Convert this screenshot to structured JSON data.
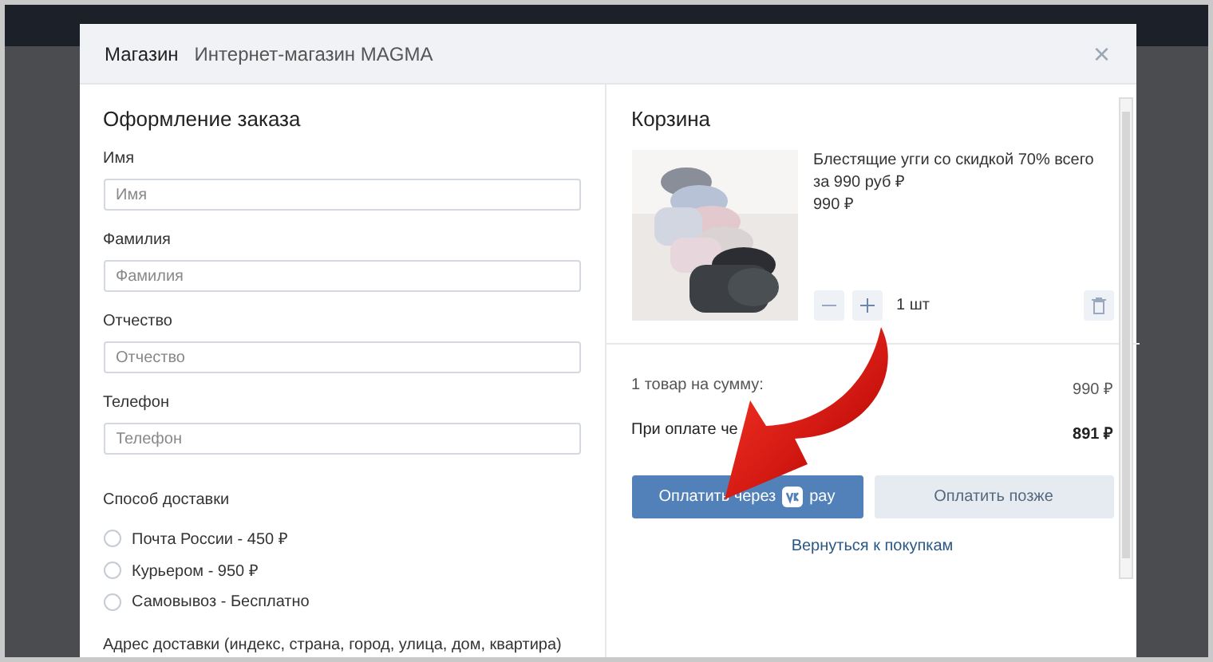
{
  "header": {
    "section": "Магазин",
    "shop": "Интернет-магазин MAGMA",
    "close": "×"
  },
  "form": {
    "title": "Оформление заказа",
    "fields": [
      {
        "label": "Имя",
        "placeholder": "Имя"
      },
      {
        "label": "Фамилия",
        "placeholder": "Фамилия"
      },
      {
        "label": "Отчество",
        "placeholder": "Отчество"
      },
      {
        "label": "Телефон",
        "placeholder": "Телефон"
      }
    ],
    "delivery": {
      "label": "Способ доставки",
      "options": [
        {
          "label": "Почта России - 450 ₽",
          "selected": false
        },
        {
          "label": "Курьером - 950 ₽",
          "selected": false
        },
        {
          "label": "Самовывоз - Бесплатно",
          "selected": false
        }
      ]
    },
    "address_label": "Адрес доставки (индекс, страна, город, улица, дом, квартира)"
  },
  "cart": {
    "title": "Корзина",
    "items": [
      {
        "kind": "picture",
        "name": "Блестящие угги со скидкой 70% всего за 990 руб ₽",
        "price": "990 ₽",
        "quantity": "1 шт"
      }
    ],
    "summary": [
      {
        "label": "1 товар на сумму:",
        "value": "990 ₽",
        "bold": false
      },
      {
        "label": "При оплате че",
        "value": "891 ₽",
        "bold": true
      }
    ],
    "pay_button": {
      "label": "Оплатить через",
      "suffix": "pay"
    },
    "later_button": "Оплатить позже",
    "back_link": "Вернуться к покупкам"
  }
}
